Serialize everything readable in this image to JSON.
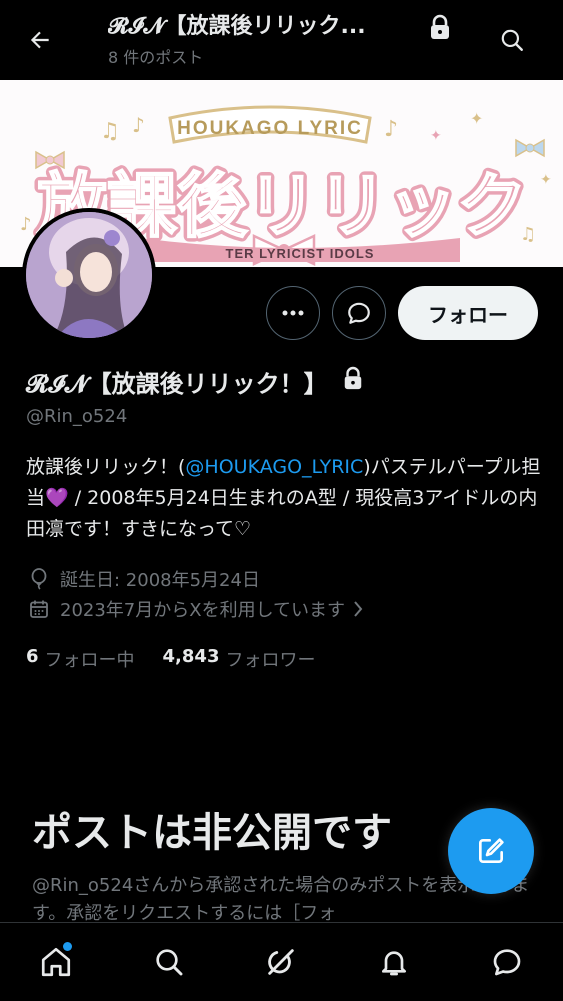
{
  "header": {
    "title": "𝓡𝓘𝓝【放課後リリック...",
    "post_count": "8 件のポスト"
  },
  "banner": {
    "top_text": "HOUKAGO LYRIC",
    "main_text": "放課後リリック",
    "sub_text": "TER LYRICIST IDOLS",
    "colors": {
      "pink": "#e8a3b4",
      "gold": "#d9c08a",
      "bg": "#fdfbfc"
    }
  },
  "profile": {
    "display_name": "𝓡𝓘𝓝【放課後リリック！】",
    "handle": "@Rin_o524",
    "bio_before": "放課後リリック！(",
    "bio_link": "@HOUKAGO_LYRIC",
    "bio_after": ")パステルパープル担当",
    "bio_heart": "💜",
    "bio_rest": " / 2008年5月24日生まれのA型 / 現役高3アイドルの内田凛です！すきになって♡",
    "birthday": "誕生日: 2008年5月24日",
    "joined": "2023年7月からXを利用しています",
    "following_count": "6",
    "following_label": "フォロー中",
    "followers_count": "4,843",
    "followers_label": "フォロワー"
  },
  "actions": {
    "follow_label": "フォロー"
  },
  "private": {
    "title": "ポストは非公開です",
    "description": "@Rin_o524さんから承認された場合のみポストを表示できます。承認をリクエストするには［フォ"
  },
  "icons": {
    "back": "arrow-left-icon",
    "search": "search-icon",
    "lock": "lock-icon",
    "more": "more-icon",
    "message": "message-icon",
    "balloon": "balloon-icon",
    "calendar": "calendar-icon",
    "compose": "compose-icon",
    "home": "home-icon",
    "grok": "grok-icon",
    "bell": "bell-icon",
    "chat": "chat-icon"
  },
  "colors": {
    "accent": "#1d9bf0",
    "muted": "#71767b",
    "text": "#e7e9ea"
  }
}
